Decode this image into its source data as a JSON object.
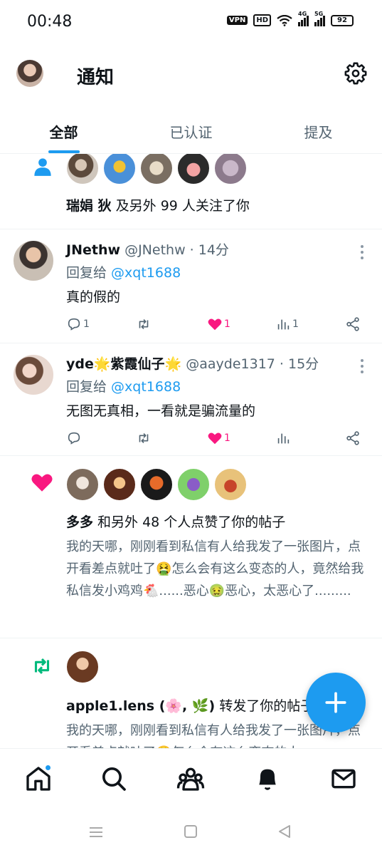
{
  "status_bar": {
    "time": "00:48",
    "vpn": "VPN",
    "hd": "HD",
    "net1": "4G",
    "net2": "5G",
    "battery": "92"
  },
  "header": {
    "title": "通知"
  },
  "tabs": [
    {
      "label": "全部",
      "active": true
    },
    {
      "label": "已认证",
      "active": false
    },
    {
      "label": "提及",
      "active": false
    }
  ],
  "follow_notice": {
    "icon": "person-icon",
    "user": "瑞娟 狄",
    "text": " 及另外 99 人关注了你"
  },
  "tweets": [
    {
      "name": "JNethw",
      "handle": "@JNethw",
      "time": "14分",
      "reply_prefix": "回复给 ",
      "reply_to": "@xqt1688",
      "text": "真的假的",
      "replies": "1",
      "retweets": "",
      "likes": "1",
      "views": "1"
    },
    {
      "name": "yde🌟紫霞仙子🌟",
      "handle": "@aayde1317",
      "time": "15分",
      "reply_prefix": "回复给 ",
      "reply_to": "@xqt1688",
      "text": "无图无真相，一看就是骗流量的",
      "replies": "",
      "retweets": "",
      "likes": "1",
      "views": ""
    }
  ],
  "like_notice": {
    "user": "多多",
    "text": " 和另外 48 个人点赞了你的帖子",
    "body": "我的天哪，刚刚看到私信有人给我发了一张图片，点开看差点就吐了🤮怎么会有这么变态的人，竟然给我私信发小鸡鸡🐔......恶心🤢恶心，太恶心了........."
  },
  "retweet_notice": {
    "user": "apple1.lens (🌸, 🌿)",
    "text": " 转发了你的帖子",
    "body": "我的天哪，刚刚看到私信有人给我发了一张图片，点开看差点就吐了🤮怎么会有这么变态的人"
  },
  "colors": {
    "accent": "#1d9bf0",
    "like": "#f91880",
    "retweet": "#00ba7c",
    "muted": "#536471"
  }
}
